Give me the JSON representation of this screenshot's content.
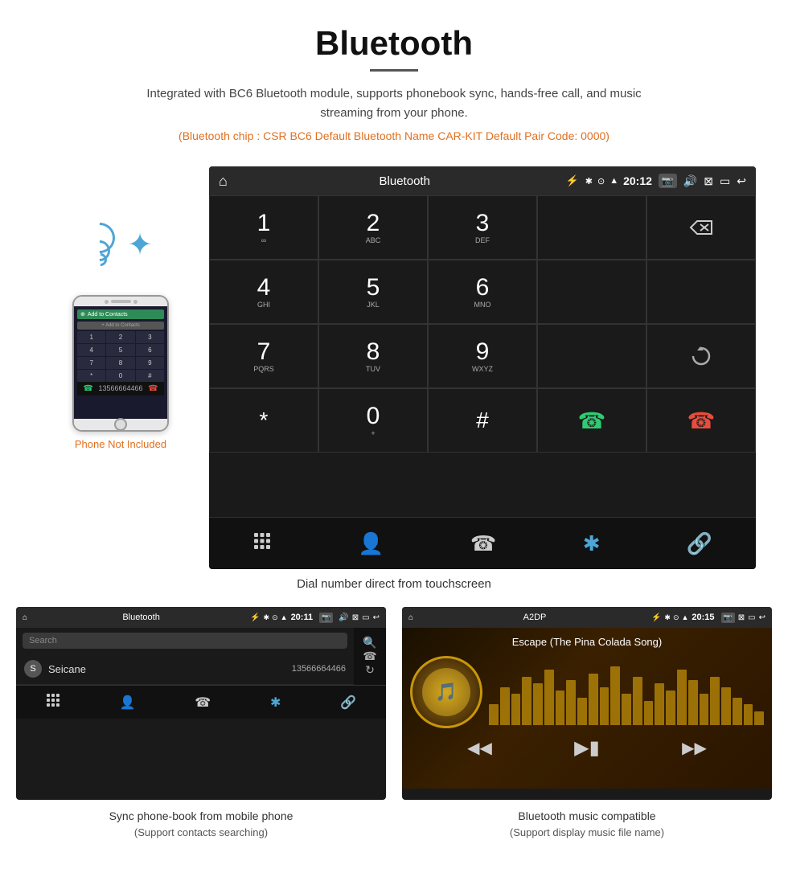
{
  "page": {
    "title": "Bluetooth",
    "subtitle": "Integrated with BC6 Bluetooth module, supports phonebook sync, hands-free call, and music streaming from your phone.",
    "specs": "(Bluetooth chip : CSR BC6    Default Bluetooth Name CAR-KIT    Default Pair Code: 0000)",
    "main_caption": "Dial number direct from touchscreen",
    "phone_not_included": "Phone Not Included"
  },
  "status_bar": {
    "home_icon": "⌂",
    "title": "Bluetooth",
    "usb_icon": "⚡",
    "bt_icon": "✱",
    "location_icon": "⊙",
    "signal_icon": "▲",
    "time": "20:12",
    "camera_icon": "📷",
    "volume_icon": "🔊",
    "close_icon": "⊠",
    "window_icon": "▭",
    "back_icon": "↩"
  },
  "dialpad": {
    "keys": [
      {
        "num": "1",
        "letters": "∞"
      },
      {
        "num": "2",
        "letters": "ABC"
      },
      {
        "num": "3",
        "letters": "DEF"
      },
      {
        "num": "empty",
        "letters": ""
      },
      {
        "num": "backspace",
        "letters": ""
      },
      {
        "num": "4",
        "letters": "GHI"
      },
      {
        "num": "5",
        "letters": "JKL"
      },
      {
        "num": "6",
        "letters": "MNO"
      },
      {
        "num": "empty2",
        "letters": ""
      },
      {
        "num": "empty3",
        "letters": ""
      },
      {
        "num": "7",
        "letters": "PQRS"
      },
      {
        "num": "8",
        "letters": "TUV"
      },
      {
        "num": "9",
        "letters": "WXYZ"
      },
      {
        "num": "empty4",
        "letters": ""
      },
      {
        "num": "redial",
        "letters": ""
      },
      {
        "num": "*",
        "letters": ""
      },
      {
        "num": "0",
        "letters": "+"
      },
      {
        "num": "#",
        "letters": ""
      },
      {
        "num": "call",
        "letters": ""
      },
      {
        "num": "end",
        "letters": ""
      }
    ]
  },
  "toolbar": {
    "dialpad_icon": "⠿",
    "contacts_icon": "👤",
    "phone_icon": "☎",
    "bt_icon": "✱",
    "link_icon": "🔗"
  },
  "phonebook_screen": {
    "status_title": "Bluetooth",
    "time": "20:11",
    "search_placeholder": "Search",
    "contacts": [
      {
        "initial": "S",
        "name": "Seicane",
        "phone": "13566664466"
      }
    ],
    "caption": "Sync phone-book from mobile phone",
    "caption_sub": "(Support contacts searching)"
  },
  "music_screen": {
    "status_title": "A2DP",
    "time": "20:15",
    "song_title": "Escape (The Pina Colada Song)",
    "eq_bars": [
      30,
      55,
      45,
      70,
      60,
      80,
      50,
      65,
      40,
      75,
      55,
      85,
      45,
      70,
      35,
      60,
      50,
      80,
      65,
      45,
      70,
      55,
      40,
      30,
      20
    ],
    "caption": "Bluetooth music compatible",
    "caption_sub": "(Support display music file name)"
  }
}
